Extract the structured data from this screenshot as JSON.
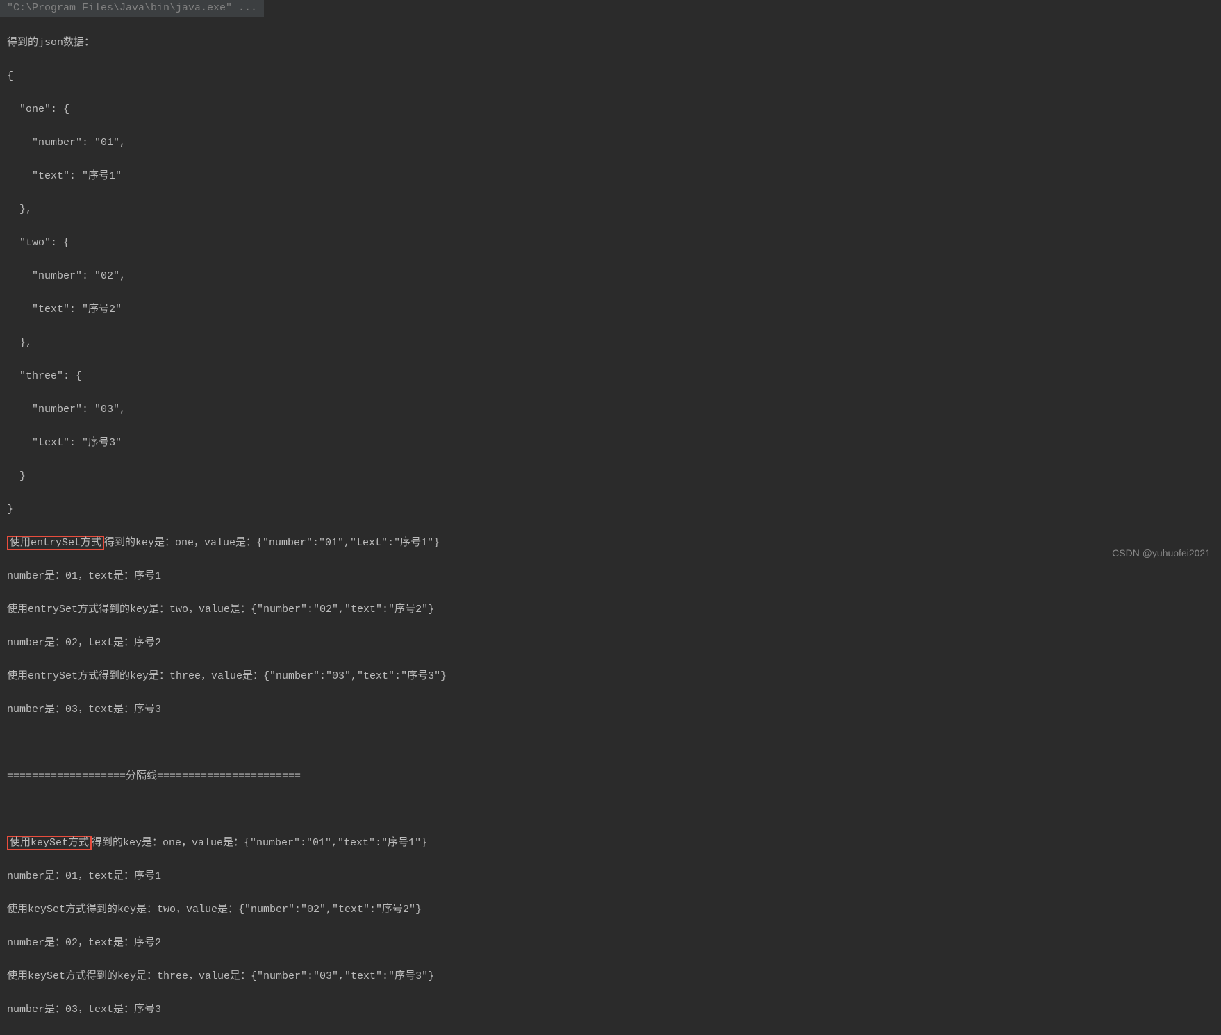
{
  "header": {
    "command": "\"C:\\Program Files\\Java\\bin\\java.exe\" ..."
  },
  "output": {
    "jsonHeader": "得到的json数据：",
    "jsonLines": [
      "{",
      "  \"one\": {",
      "    \"number\": \"01\",",
      "    \"text\": \"序号1\"",
      "  },",
      "  \"two\": {",
      "    \"number\": \"02\",",
      "    \"text\": \"序号2\"",
      "  },",
      "  \"three\": {",
      "    \"number\": \"03\",",
      "    \"text\": \"序号3\"",
      "  }",
      "}"
    ],
    "entrySetHighlight": "使用entrySet方式",
    "entrySetLine1Rest": "得到的key是：one，value是：{\"number\":\"01\",\"text\":\"序号1\"}",
    "entrySetResult1": "number是：01，text是：序号1",
    "entrySetLine2": "使用entrySet方式得到的key是：two，value是：{\"number\":\"02\",\"text\":\"序号2\"}",
    "entrySetResult2": "number是：02，text是：序号2",
    "entrySetLine3": "使用entrySet方式得到的key是：three，value是：{\"number\":\"03\",\"text\":\"序号3\"}",
    "entrySetResult3": "number是：03，text是：序号3",
    "separator": "===================分隔线=======================",
    "keySetHighlight": "使用keySet方式",
    "keySetLine1Rest": "得到的key是：one，value是：{\"number\":\"01\",\"text\":\"序号1\"}",
    "keySetResult1": "number是：01，text是：序号1",
    "keySetLine2": "使用keySet方式得到的key是：two，value是：{\"number\":\"02\",\"text\":\"序号2\"}",
    "keySetResult2": "number是：02，text是：序号2",
    "keySetLine3": "使用keySet方式得到的key是：three，value是：{\"number\":\"03\",\"text\":\"序号3\"}",
    "keySetResult3": "number是：03，text是：序号3"
  },
  "watermark": "CSDN @yuhuofei2021"
}
